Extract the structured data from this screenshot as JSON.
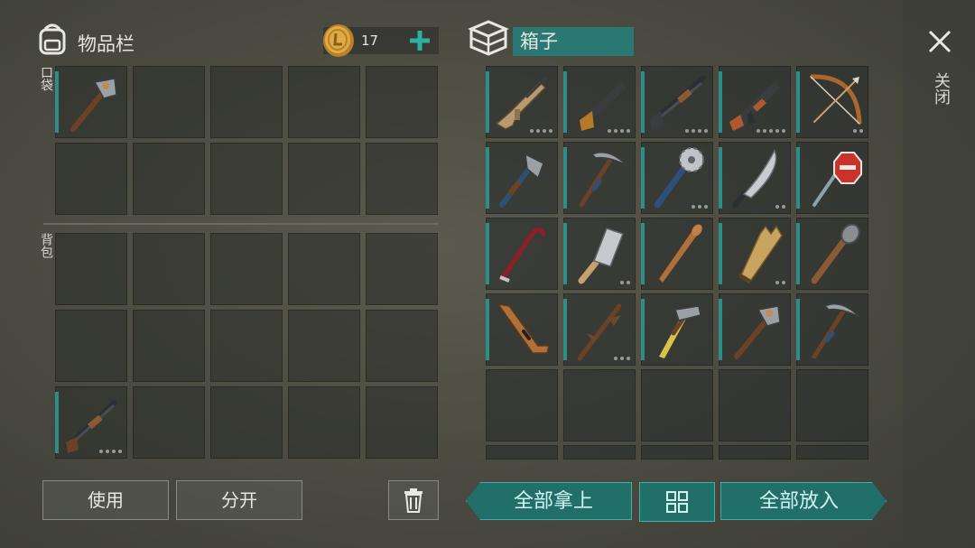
{
  "inventory": {
    "title": "物品栏",
    "pocket_label": "口袋",
    "backpack_label": "背包",
    "coins": "17",
    "pocket_items": [
      {
        "icon": "sledgehammer-icon"
      },
      {
        "icon": ""
      },
      {
        "icon": ""
      },
      {
        "icon": ""
      },
      {
        "icon": ""
      },
      {
        "icon": ""
      },
      {
        "icon": ""
      },
      {
        "icon": ""
      },
      {
        "icon": ""
      },
      {
        "icon": ""
      }
    ],
    "backpack_items": [
      {
        "icon": ""
      },
      {
        "icon": ""
      },
      {
        "icon": ""
      },
      {
        "icon": ""
      },
      {
        "icon": ""
      },
      {
        "icon": ""
      },
      {
        "icon": ""
      },
      {
        "icon": ""
      },
      {
        "icon": ""
      },
      {
        "icon": ""
      },
      {
        "icon": "shotgun-icon"
      },
      {
        "icon": ""
      },
      {
        "icon": ""
      },
      {
        "icon": ""
      },
      {
        "icon": ""
      }
    ],
    "use_button": "使用",
    "split_button": "分开"
  },
  "box": {
    "title": "箱子",
    "items": [
      {
        "icon": "assault-rifle-icon"
      },
      {
        "icon": "pistol-icon"
      },
      {
        "icon": "pump-shotgun-icon"
      },
      {
        "icon": "ak-rifle-icon"
      },
      {
        "icon": "bow-icon"
      },
      {
        "icon": "axe-icon"
      },
      {
        "icon": "pickaxe-icon"
      },
      {
        "icon": "saw-blade-mace-icon"
      },
      {
        "icon": "machete-icon"
      },
      {
        "icon": "stop-sign-icon"
      },
      {
        "icon": "crowbar-icon"
      },
      {
        "icon": "cleaver-icon"
      },
      {
        "icon": "baseball-bat-icon"
      },
      {
        "icon": "broken-board-icon"
      },
      {
        "icon": "nailed-bat-icon"
      },
      {
        "icon": "hockey-stick-icon"
      },
      {
        "icon": "spiked-stick-icon"
      },
      {
        "icon": "hammer-icon"
      },
      {
        "icon": "sledgehammer-icon"
      },
      {
        "icon": "pickaxe-icon"
      }
    ],
    "take_all_button": "全部拿上",
    "put_all_button": "全部放入"
  },
  "close_label": "关闭",
  "colors": {
    "accent": "#2f8d88",
    "button_teal": "#216f69",
    "coin": "#d8a23a"
  }
}
